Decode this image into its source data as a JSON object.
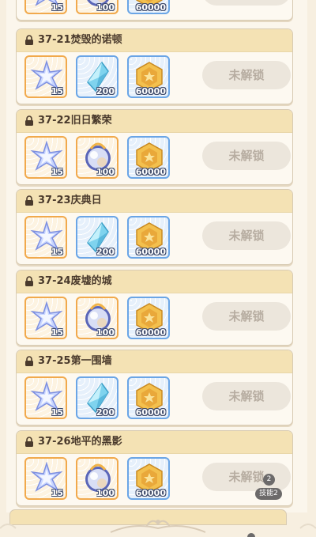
{
  "stages": [
    {
      "title": "37-21焚毁的诺顿",
      "rewards": [
        {
          "type": "star-crystal",
          "qty": "15"
        },
        {
          "type": "blue-crystal",
          "qty": "200"
        },
        {
          "type": "gold-coin",
          "qty": "60000"
        }
      ],
      "button": "未解锁"
    },
    {
      "title": "37-22旧日繁荣",
      "rewards": [
        {
          "type": "star-crystal",
          "qty": "15"
        },
        {
          "type": "moon-orb",
          "qty": "100"
        },
        {
          "type": "gold-coin",
          "qty": "60000"
        }
      ],
      "button": "未解锁"
    },
    {
      "title": "37-23庆典日",
      "rewards": [
        {
          "type": "star-crystal",
          "qty": "15"
        },
        {
          "type": "blue-crystal",
          "qty": "200"
        },
        {
          "type": "gold-coin",
          "qty": "60000"
        }
      ],
      "button": "未解锁"
    },
    {
      "title": "37-24废墟的城",
      "rewards": [
        {
          "type": "star-crystal",
          "qty": "15"
        },
        {
          "type": "moon-orb",
          "qty": "100"
        },
        {
          "type": "gold-coin",
          "qty": "60000"
        }
      ],
      "button": "未解锁"
    },
    {
      "title": "37-25第一围墙",
      "rewards": [
        {
          "type": "star-crystal",
          "qty": "15"
        },
        {
          "type": "blue-crystal",
          "qty": "200"
        },
        {
          "type": "gold-coin",
          "qty": "60000"
        }
      ],
      "button": "未解锁"
    },
    {
      "title": "37-26地平的黑影",
      "rewards": [
        {
          "type": "star-crystal",
          "qty": "15"
        },
        {
          "type": "moon-orb",
          "qty": "100"
        },
        {
          "type": "gold-coin",
          "qty": "60000"
        }
      ],
      "button": "未解锁"
    }
  ],
  "top_partial": {
    "rewards": [
      {
        "type": "star-crystal",
        "qty": "15"
      },
      {
        "type": "moon-orb",
        "qty": "100"
      },
      {
        "type": "gold-coin",
        "qty": "60000"
      }
    ]
  },
  "skill": {
    "badge": "技能2",
    "count": "2"
  },
  "colors": {
    "header": "#f4e2b4",
    "orange_frame": "#f1a94c",
    "blue_frame": "#6aa5e6",
    "button_bg": "#ece6dc",
    "button_text": "#b7ada1"
  }
}
